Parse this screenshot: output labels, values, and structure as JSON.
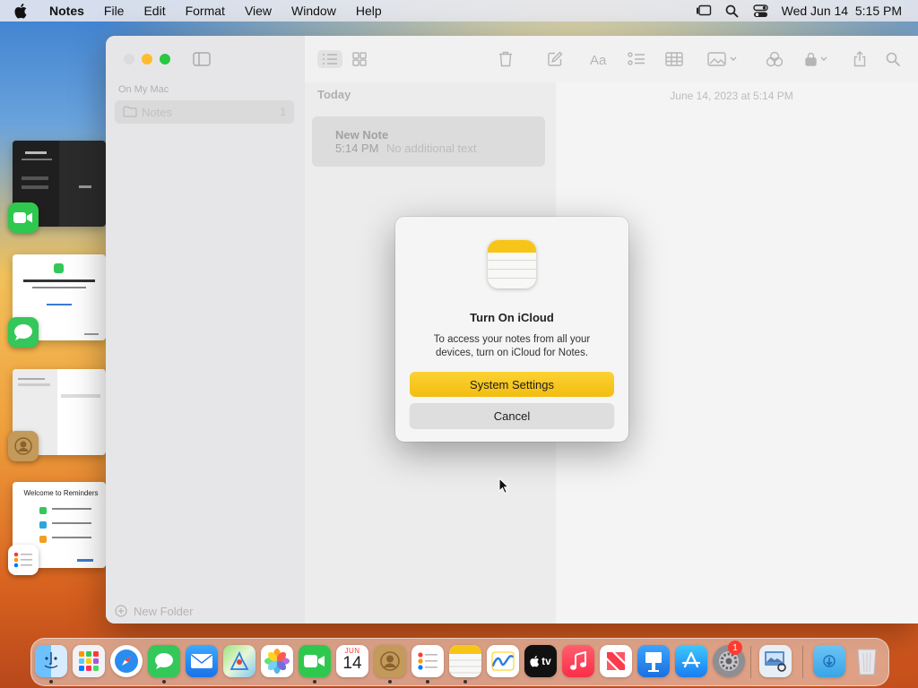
{
  "menubar": {
    "app_name": "Notes",
    "menus": [
      "File",
      "Edit",
      "Format",
      "View",
      "Window",
      "Help"
    ],
    "datetime": "Wed Jun 14  5:15 PM"
  },
  "sidebar": {
    "section": "On My Mac",
    "folder": "Notes",
    "folder_count": "1",
    "new_folder": "New Folder"
  },
  "note_list": {
    "group": "Today",
    "note_title": "New Note",
    "note_time": "5:14 PM",
    "note_preview": "No additional text"
  },
  "detail": {
    "date": "June 14, 2023 at 5:14 PM"
  },
  "dialog": {
    "title": "Turn On iCloud",
    "message": "To access your notes from all your devices, turn on iCloud for Notes.",
    "primary_button": "System Settings",
    "secondary_button": "Cancel"
  },
  "stage_manager": {
    "reminders_heading": "Welcome to Reminders"
  },
  "dock": {
    "calendar_month": "JUN",
    "calendar_day": "14",
    "tv_label": "tv",
    "settings_badge": "1"
  },
  "colors": {
    "accent_yellow": "#f7c518",
    "close_red": "#ff5f57",
    "minimize_yellow": "#febc2e",
    "zoom_green": "#28c840"
  }
}
